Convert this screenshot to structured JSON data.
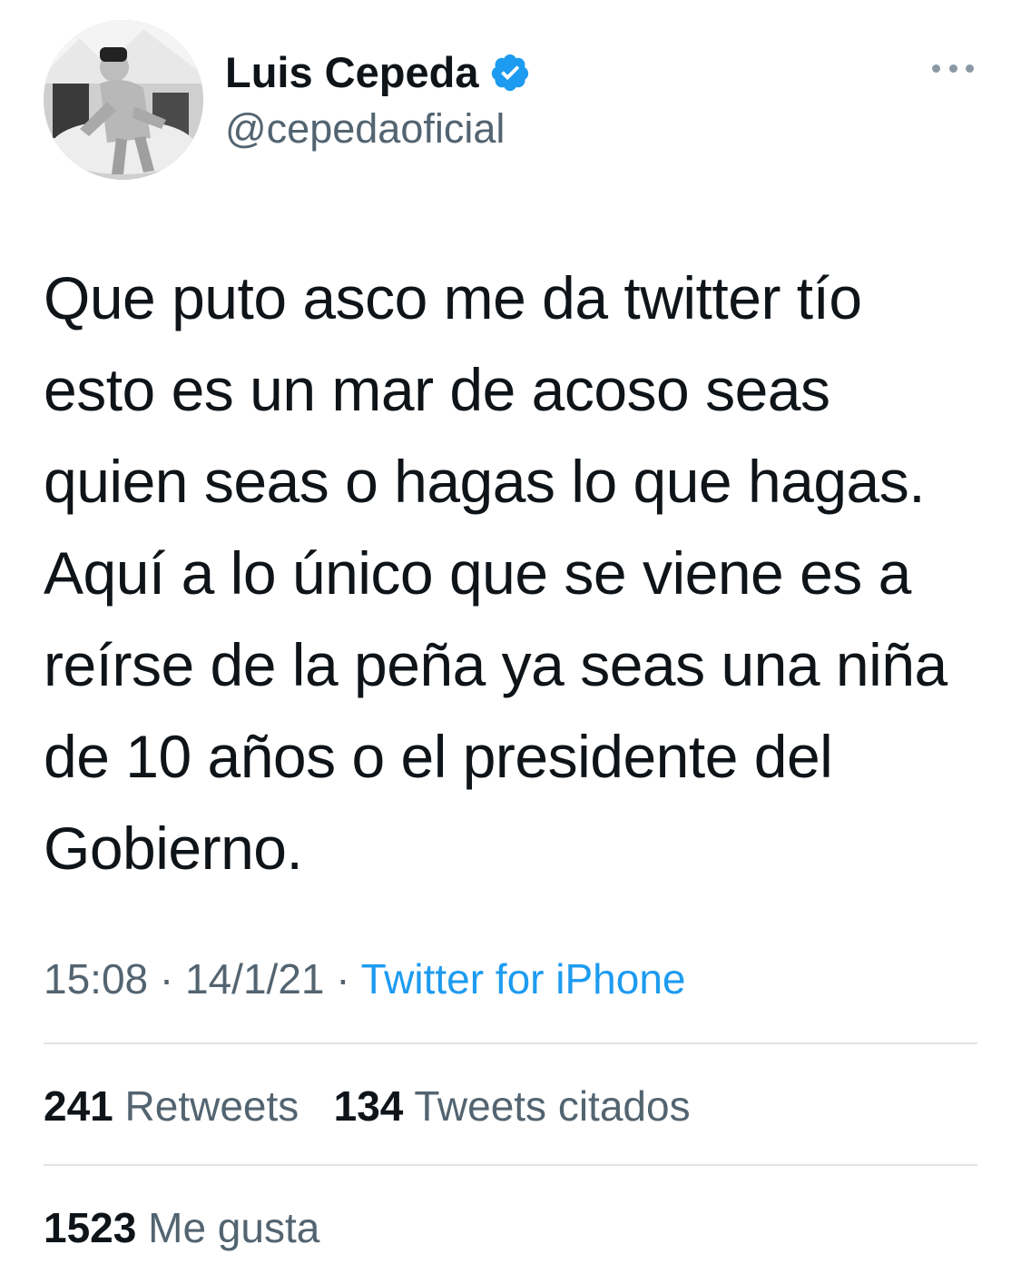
{
  "author": {
    "display_name": "Luis Cepeda",
    "handle": "@cepedaoficial",
    "verified_icon": "verified-badge-icon",
    "avatar_icon": "profile-photo"
  },
  "tweet": {
    "lines": [
      "Que puto asco me da twitter tío",
      "esto es un mar de acoso seas",
      "quien seas o hagas lo que hagas.",
      "Aquí a lo único que se viene es a",
      "reírse de la peña ya seas una niña",
      "de 10 años o el presidente del",
      "Gobierno."
    ]
  },
  "meta": {
    "time": "15:08",
    "separator": "·",
    "date": "14/1/21",
    "source": "Twitter for iPhone"
  },
  "stats": {
    "retweets_count": "241",
    "retweets_label": "Retweets",
    "quotes_count": "134",
    "quotes_label": "Tweets citados",
    "likes_count": "1523",
    "likes_label": "Me gusta"
  },
  "colors": {
    "text": "#0f1419",
    "secondary": "#536471",
    "link": "#1d9bf0",
    "verified": "#1d9bf0",
    "divider": "#e1e5e8"
  },
  "icons": {
    "more": "more-options-icon"
  }
}
